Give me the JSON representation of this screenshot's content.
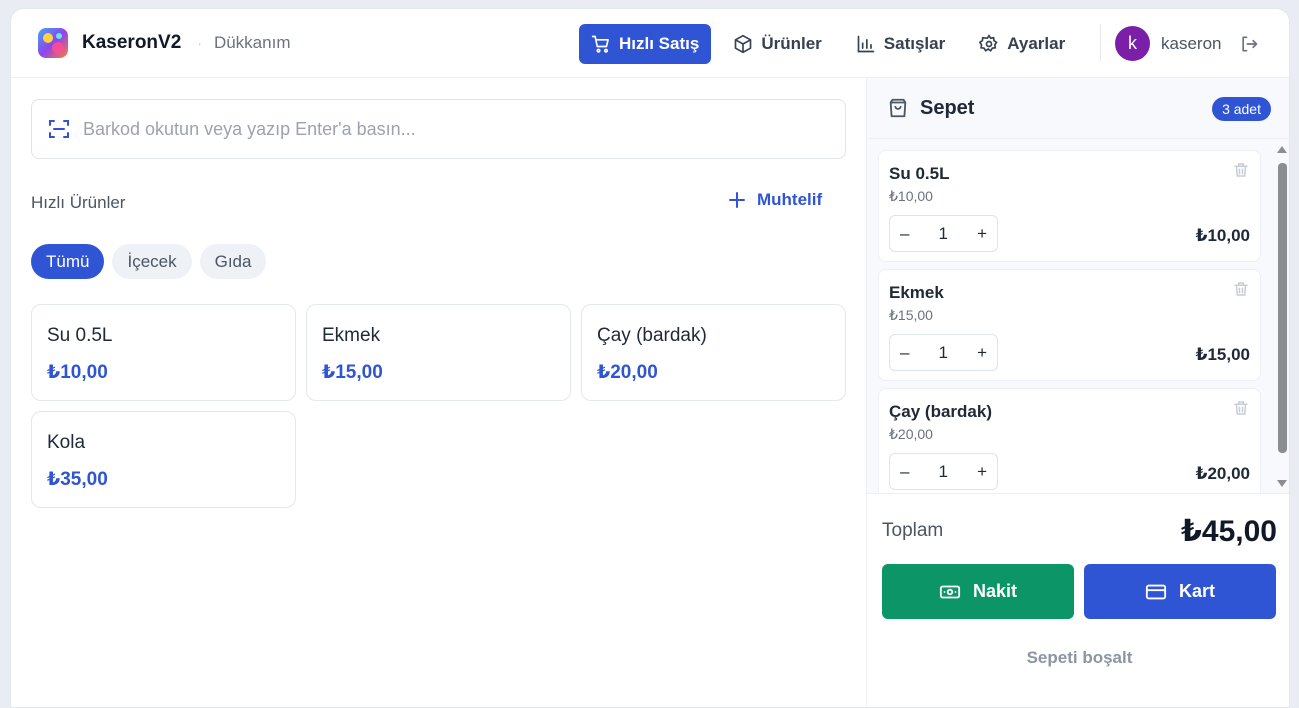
{
  "header": {
    "brand_name": "KaseronV2",
    "separator": "·",
    "shop_name": "Dükkanım",
    "nav": [
      {
        "label": "Hızlı Satış",
        "icon": "cart-icon",
        "active": true
      },
      {
        "label": "Ürünler",
        "icon": "box-icon",
        "active": false
      },
      {
        "label": "Satışlar",
        "icon": "bar-chart-icon",
        "active": false
      },
      {
        "label": "Ayarlar",
        "icon": "gear-icon",
        "active": false
      }
    ],
    "user": {
      "initial": "k",
      "name": "kaseron",
      "avatar_color": "#7c1fa8"
    }
  },
  "search": {
    "placeholder": "Barkod okutun veya yazıp Enter'a basın...",
    "value": ""
  },
  "quick_products": {
    "title": "Hızlı Ürünler",
    "misc_label": "Muhtelif",
    "categories": [
      {
        "label": "Tümü",
        "active": true
      },
      {
        "label": "İçecek",
        "active": false
      },
      {
        "label": "Gıda",
        "active": false
      }
    ],
    "products": [
      {
        "name": "Su 0.5L",
        "price": "₺10,00"
      },
      {
        "name": "Ekmek",
        "price": "₺15,00"
      },
      {
        "name": "Çay (bardak)",
        "price": "₺20,00"
      },
      {
        "name": "Kola",
        "price": "₺35,00"
      }
    ]
  },
  "cart": {
    "title": "Sepet",
    "badge": "3 adet",
    "items": [
      {
        "name": "Su 0.5L",
        "unit_price": "₺10,00",
        "qty": "1",
        "total": "₺10,00"
      },
      {
        "name": "Ekmek",
        "unit_price": "₺15,00",
        "qty": "1",
        "total": "₺15,00"
      },
      {
        "name": "Çay (bardak)",
        "unit_price": "₺20,00",
        "qty": "1",
        "total": "₺20,00"
      }
    ],
    "stepper": {
      "minus": "–",
      "plus": "+"
    },
    "total_label": "Toplam",
    "total_value": "₺45,00",
    "cash_label": "Nakit",
    "card_label": "Kart",
    "clear_label": "Sepeti boşalt"
  },
  "colors": {
    "primary": "#2f55d4",
    "cash": "#0c9566",
    "avatar": "#7c1fa8"
  }
}
